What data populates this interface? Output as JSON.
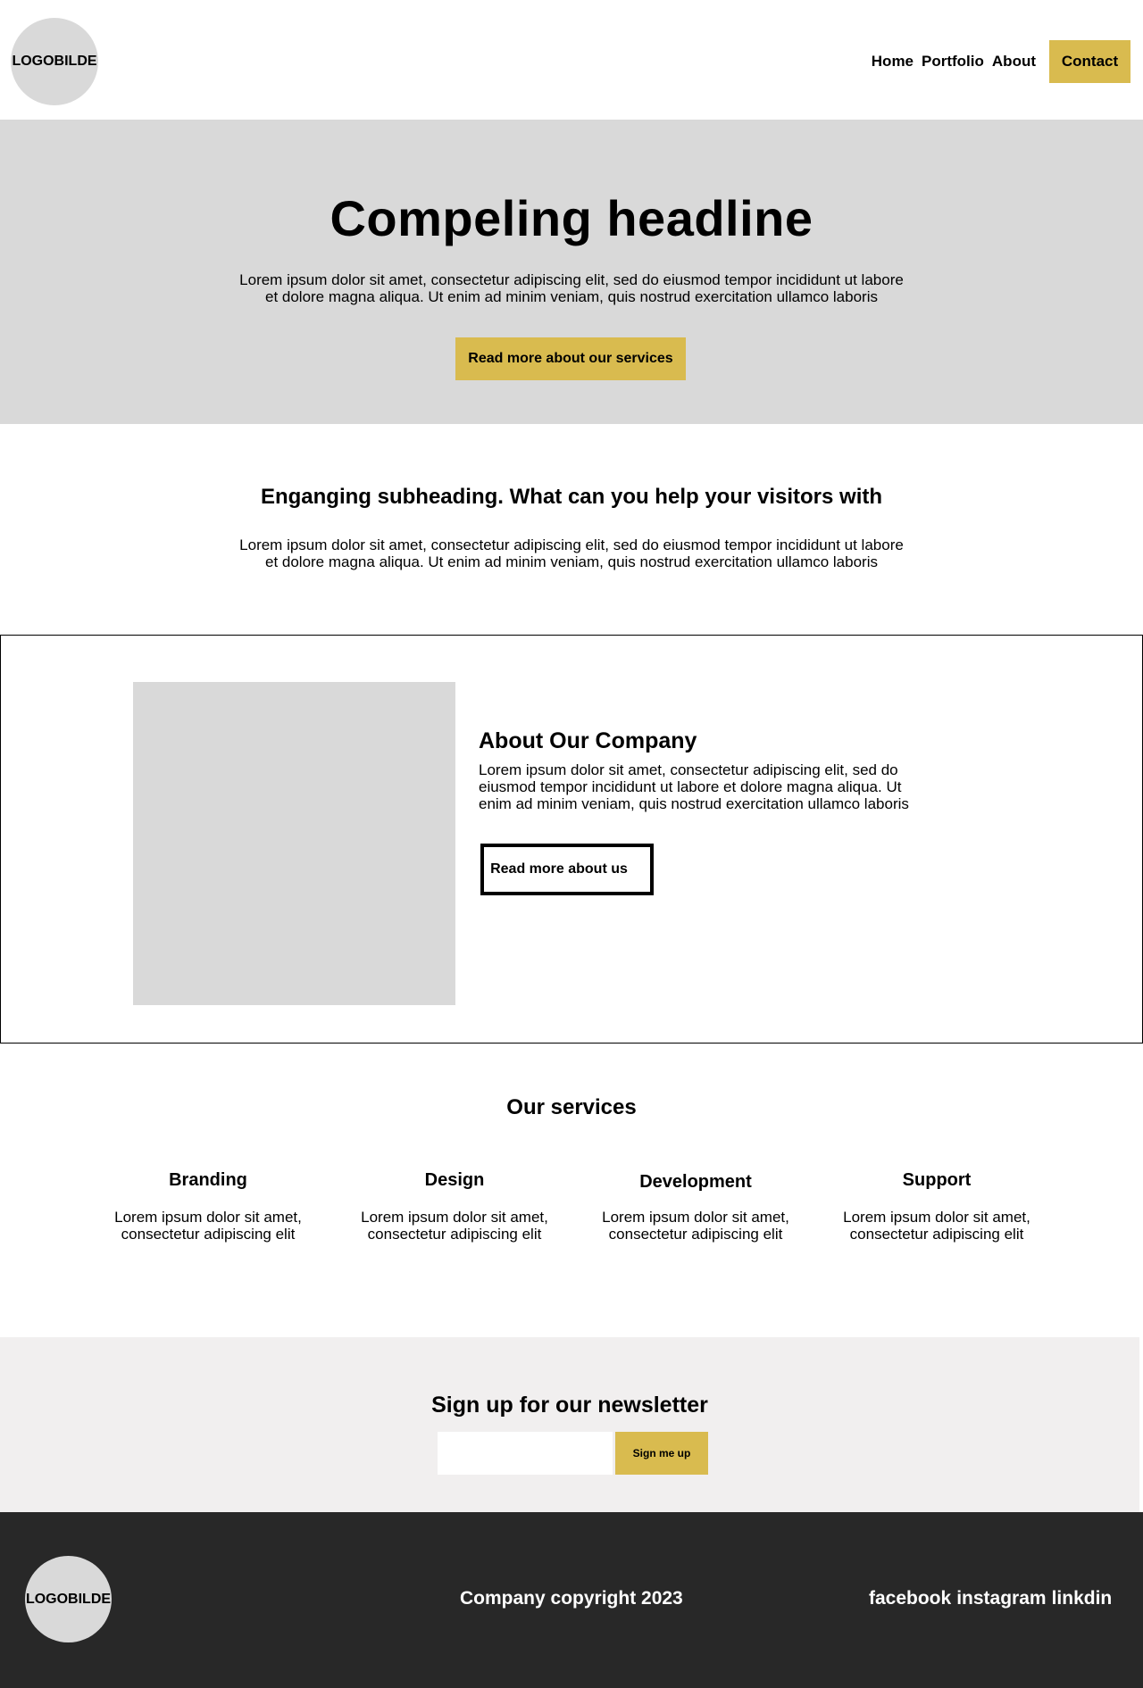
{
  "header": {
    "logo_text": "LOGOBILDE",
    "nav": {
      "home": "Home",
      "portfolio": "Portfolio",
      "about": "About",
      "contact": "Contact"
    }
  },
  "hero": {
    "headline": "Compeling headline",
    "body": "Lorem ipsum dolor sit amet, consectetur adipiscing elit, sed do eiusmod tempor incididunt ut labore et dolore magna aliqua. Ut enim ad minim veniam, quis nostrud exercitation ullamco laboris",
    "cta": "Read more about our services"
  },
  "subheading": {
    "title": "Enganging subheading. What can you help your visitors with",
    "body": "Lorem ipsum dolor sit amet, consectetur adipiscing elit, sed do eiusmod tempor incididunt ut labore et dolore magna aliqua. Ut enim ad minim veniam, quis nostrud exercitation ullamco laboris"
  },
  "about": {
    "title": "About Our Company",
    "body": "Lorem ipsum dolor sit amet, consectetur adipiscing elit, sed do eiusmod tempor incididunt ut labore et dolore magna aliqua. Ut enim ad minim veniam, quis nostrud exercitation ullamco laboris",
    "cta": "Read more about us"
  },
  "services": {
    "title": "Our services",
    "items": [
      {
        "title": "Branding",
        "body": "Lorem ipsum dolor sit amet, consectetur adipiscing elit"
      },
      {
        "title": "Design",
        "body": "Lorem ipsum dolor sit amet, consectetur adipiscing elit"
      },
      {
        "title": "Development",
        "body": "Lorem ipsum dolor sit amet, consectetur adipiscing elit"
      },
      {
        "title": "Support",
        "body": "Lorem ipsum dolor sit amet, consectetur adipiscing elit"
      }
    ]
  },
  "newsletter": {
    "title": "Sign up for our newsletter",
    "input_value": "",
    "button": "Sign me up"
  },
  "footer": {
    "logo_text": "LOGOBILDE",
    "copyright": "Company copyright 2023",
    "social": {
      "facebook": "facebook",
      "instagram": "instagram",
      "linkedin": "linkdin"
    }
  },
  "colors": {
    "accent": "#d9bb4f",
    "placeholder_gray": "#d9d9d9",
    "newsletter_bg": "#f1efef",
    "footer_bg": "#282828"
  }
}
